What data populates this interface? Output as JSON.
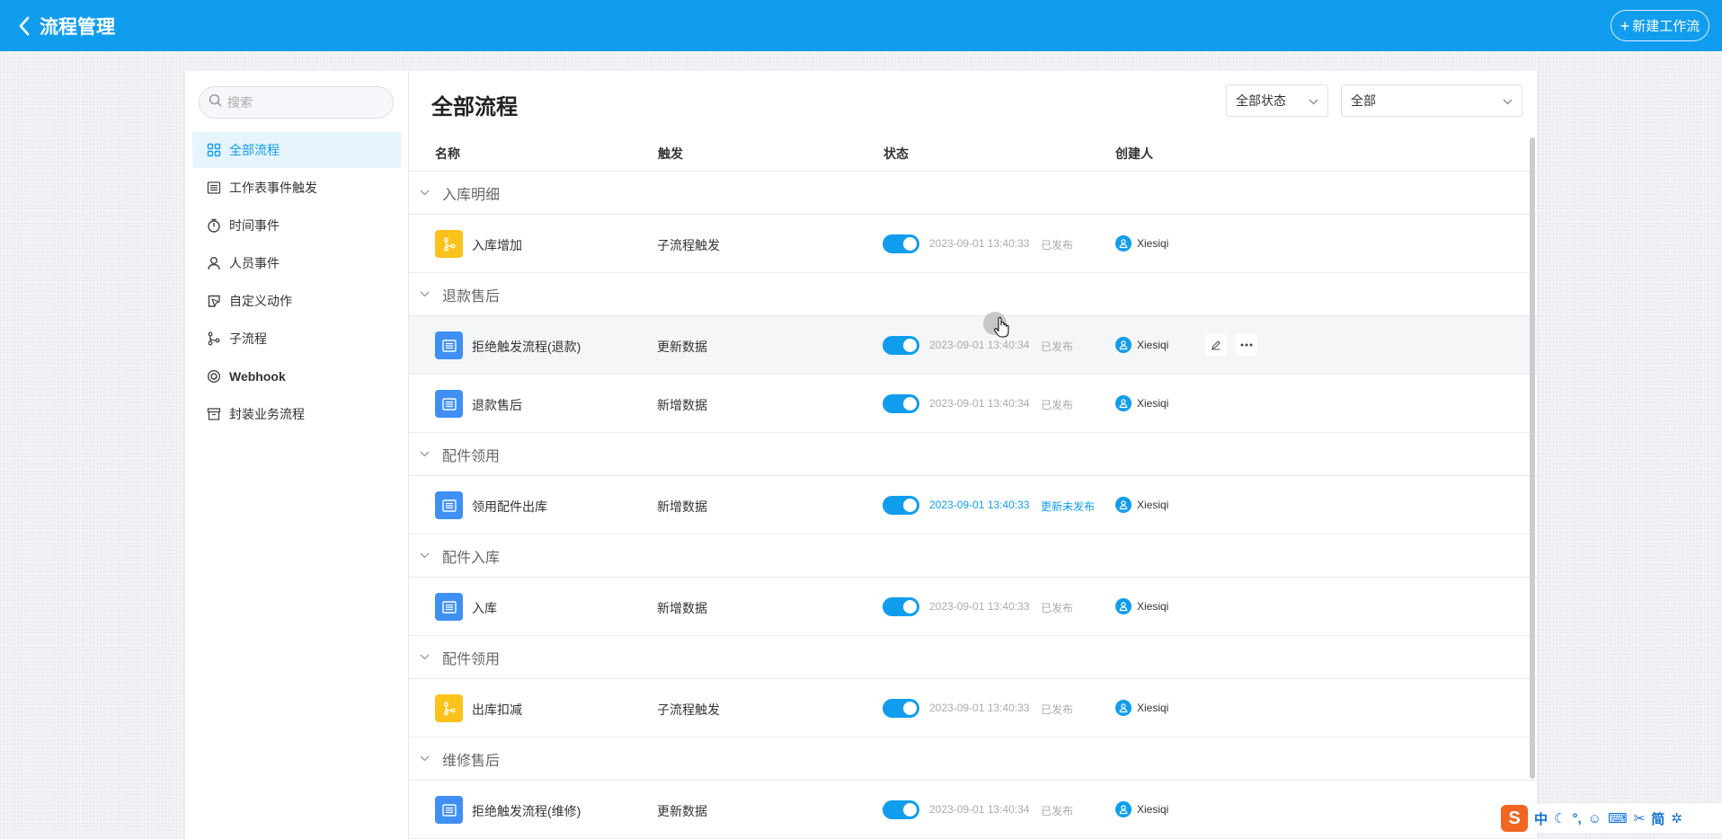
{
  "header": {
    "title": "流程管理",
    "new_button": "新建工作流"
  },
  "sidebar": {
    "search_placeholder": "搜索",
    "items": [
      {
        "label": "全部流程",
        "icon": "grid-icon",
        "active": true
      },
      {
        "label": "工作表事件触发",
        "icon": "list-icon"
      },
      {
        "label": "时间事件",
        "icon": "timer-icon"
      },
      {
        "label": "人员事件",
        "icon": "person-icon"
      },
      {
        "label": "自定义动作",
        "icon": "cursor-box-icon"
      },
      {
        "label": "子流程",
        "icon": "branch-icon"
      },
      {
        "label": "Webhook",
        "icon": "webhook-icon"
      },
      {
        "label": "封装业务流程",
        "icon": "archive-icon"
      }
    ]
  },
  "main": {
    "title": "全部流程",
    "filters": {
      "status": "全部状态",
      "scope": "全部"
    },
    "columns": {
      "name": "名称",
      "trigger": "触发",
      "status": "状态",
      "creator": "创建人"
    },
    "groups": [
      {
        "name": "入库明细",
        "rows": [
          {
            "name": "入库增加",
            "trigger": "子流程触发",
            "time": "2023-09-01 13:40:33",
            "publish": "已发布",
            "creator": "Xiesiqi",
            "icon_type": "branch",
            "enabled": true
          }
        ]
      },
      {
        "name": "退款售后",
        "rows": [
          {
            "name": "拒绝触发流程(退款)",
            "trigger": "更新数据",
            "time": "2023-09-01 13:40:34",
            "publish": "已发布",
            "creator": "Xiesiqi",
            "icon_type": "sheet",
            "enabled": true,
            "hover": true
          },
          {
            "name": "退款售后",
            "trigger": "新增数据",
            "time": "2023-09-01 13:40:34",
            "publish": "已发布",
            "creator": "Xiesiqi",
            "icon_type": "sheet",
            "enabled": true
          }
        ]
      },
      {
        "name": "配件领用",
        "rows": [
          {
            "name": "领用配件出库",
            "trigger": "新增数据",
            "time": "2023-09-01 13:40:33",
            "publish": "更新未发布",
            "creator": "Xiesiqi",
            "icon_type": "sheet",
            "enabled": true,
            "highlight": true
          }
        ]
      },
      {
        "name": "配件入库",
        "rows": [
          {
            "name": "入库",
            "trigger": "新增数据",
            "time": "2023-09-01 13:40:33",
            "publish": "已发布",
            "creator": "Xiesiqi",
            "icon_type": "sheet",
            "enabled": true
          }
        ]
      },
      {
        "name": "配件领用",
        "rows": [
          {
            "name": "出库扣减",
            "trigger": "子流程触发",
            "time": "2023-09-01 13:40:33",
            "publish": "已发布",
            "creator": "Xiesiqi",
            "icon_type": "branch",
            "enabled": true
          }
        ]
      },
      {
        "name": "维修售后",
        "rows": [
          {
            "name": "拒绝触发流程(维修)",
            "trigger": "更新数据",
            "time": "2023-09-01 13:40:34",
            "publish": "已发布",
            "creator": "Xiesiqi",
            "icon_type": "sheet",
            "enabled": true
          }
        ]
      }
    ]
  },
  "ime": {
    "logo": "S",
    "items": [
      "中",
      "☾",
      "°,",
      "☺",
      "⌨",
      "✂",
      "简",
      "✲"
    ]
  },
  "colors": {
    "primary": "#109dee",
    "sheet_icon": "#3f8ff5",
    "branch_icon": "#fcc21b"
  }
}
